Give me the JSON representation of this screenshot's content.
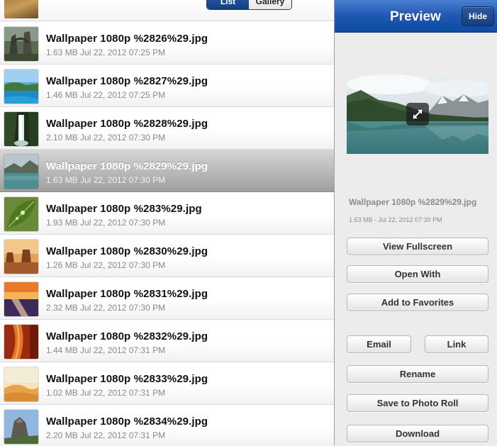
{
  "list_header": {
    "segmented": {
      "list_label": "List",
      "gallery_label": "Gallery"
    }
  },
  "files": [
    {
      "name": "Wallpaper 1080p %2826%29.jpg",
      "meta": "1.63 MB  Jul 22, 2012 07:25 PM",
      "thumb": "jungle-ruins"
    },
    {
      "name": "Wallpaper 1080p %2827%29.jpg",
      "meta": "1.46 MB  Jul 22, 2012 07:25 PM",
      "thumb": "tropical-coast"
    },
    {
      "name": "Wallpaper 1080p %2828%29.jpg",
      "meta": "2.10 MB  Jul 22, 2012 07:30 PM",
      "thumb": "waterfall"
    },
    {
      "name": "Wallpaper 1080p %2829%29.jpg",
      "meta": "1.63 MB  Jul 22, 2012 07:30 PM",
      "thumb": "mountain-lake",
      "selected": true
    },
    {
      "name": "Wallpaper 1080p %283%29.jpg",
      "meta": "1.93 MB  Jul 22, 2012 07:30 PM",
      "thumb": "green-leaf"
    },
    {
      "name": "Wallpaper 1080p %2830%29.jpg",
      "meta": "1.26 MB  Jul 22, 2012 07:30 PM",
      "thumb": "desert-buttes"
    },
    {
      "name": "Wallpaper 1080p %2831%29.jpg",
      "meta": "2.32 MB  Jul 22, 2012 07:30 PM",
      "thumb": "sunset-water"
    },
    {
      "name": "Wallpaper 1080p %2832%29.jpg",
      "meta": "1.44 MB  Jul 22, 2012 07:31 PM",
      "thumb": "red-canyon"
    },
    {
      "name": "Wallpaper 1080p %2833%29.jpg",
      "meta": "1.02 MB  Jul 22, 2012 07:31 PM",
      "thumb": "sand-dunes"
    },
    {
      "name": "Wallpaper 1080p %2834%29.jpg",
      "meta": "2.20 MB  Jul 22, 2012 07:31 PM",
      "thumb": "rocky-peak"
    }
  ],
  "preview": {
    "title": "Preview",
    "hide_label": "Hide",
    "image_icon": "expand-icon",
    "file_name": "Wallpaper 1080p %2829%29.jpg",
    "file_meta": "1.63 MB - Jul 22, 2012 07:30 PM",
    "buttons": {
      "view_fullscreen": "View Fullscreen",
      "open_with": "Open With",
      "add_to_favorites": "Add to Favorites",
      "email": "Email",
      "link": "Link",
      "rename": "Rename",
      "save_to_photo_roll": "Save to Photo Roll",
      "download": "Download"
    }
  },
  "colors": {
    "header_blue": "#1e58b2",
    "selected_row": "#a8a8a8",
    "meta_gray": "#8a8a8a"
  }
}
